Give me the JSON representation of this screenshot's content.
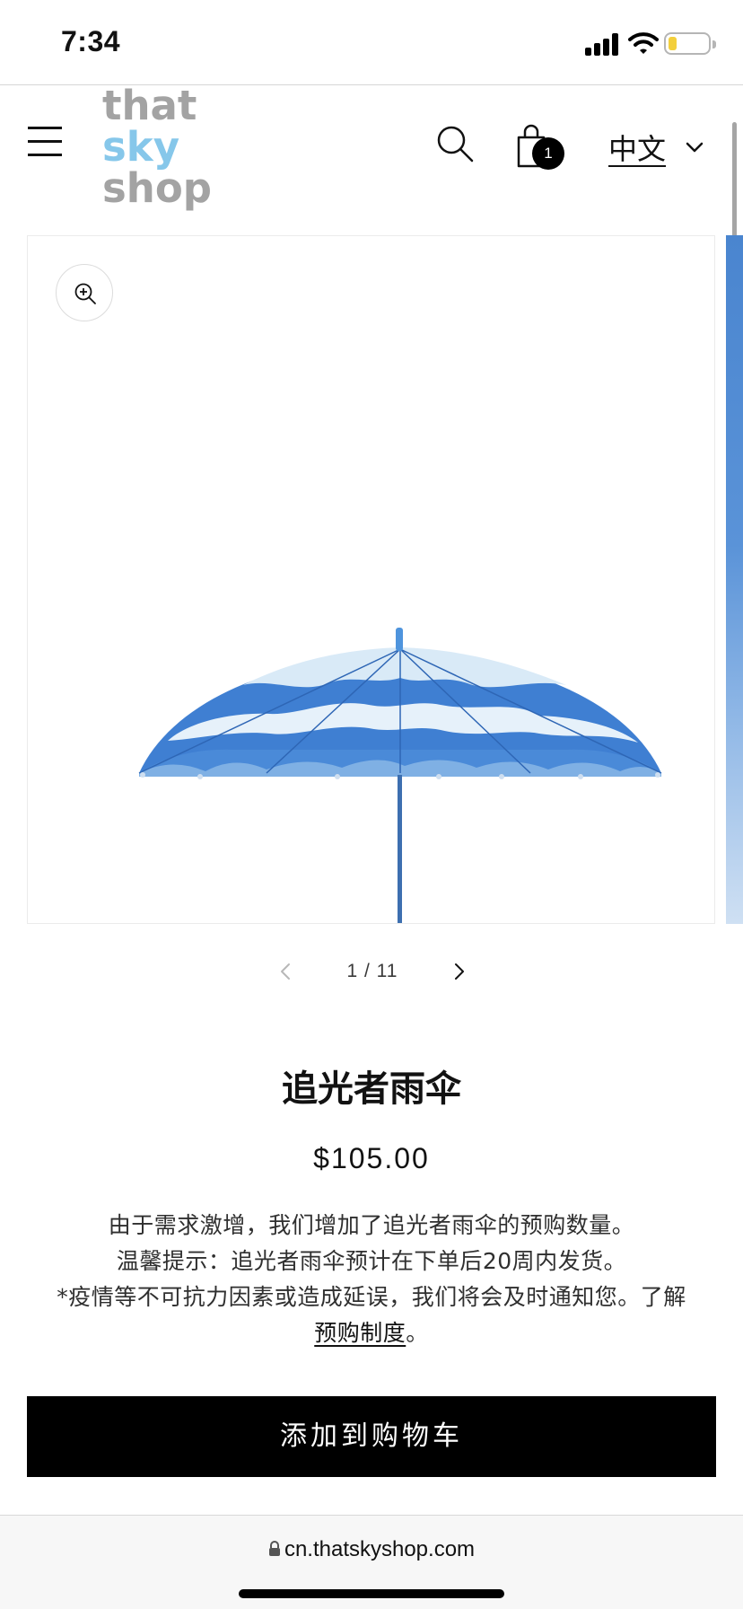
{
  "status_bar": {
    "time": "7:34",
    "icons": [
      "signal-icon",
      "wifi-icon",
      "battery-icon"
    ],
    "battery_color": "#f3cf3c"
  },
  "header": {
    "logo_lines": [
      "that",
      "sky",
      "shop"
    ],
    "logo_colors": {
      "gray": "#a3a3a3",
      "blue": "#86c7ea"
    },
    "icons": [
      "menu-icon",
      "search-icon",
      "cart-icon"
    ],
    "cart_count": "1",
    "language": "中文"
  },
  "gallery": {
    "counter": "1 / 11",
    "icons": [
      "zoom-in-icon",
      "chevron-left-icon",
      "chevron-right-icon"
    ],
    "image": "umbrella"
  },
  "product": {
    "title": "追光者雨伞",
    "price": "$105.00",
    "description_lines": [
      "由于需求激增，我们增加了追光者雨伞的预购数量。",
      "温馨提示：追光者雨伞预计在下单后20周内发货。",
      "*疫情等不可抗力因素或造成延误，我们将会及时通知您。了解"
    ],
    "preorder_link": "预购制度",
    "link_suffix": "。",
    "add_to_cart": "添加到购物车"
  },
  "browser": {
    "url": "cn.thatskyshop.com",
    "icons": [
      "lock-icon"
    ]
  }
}
